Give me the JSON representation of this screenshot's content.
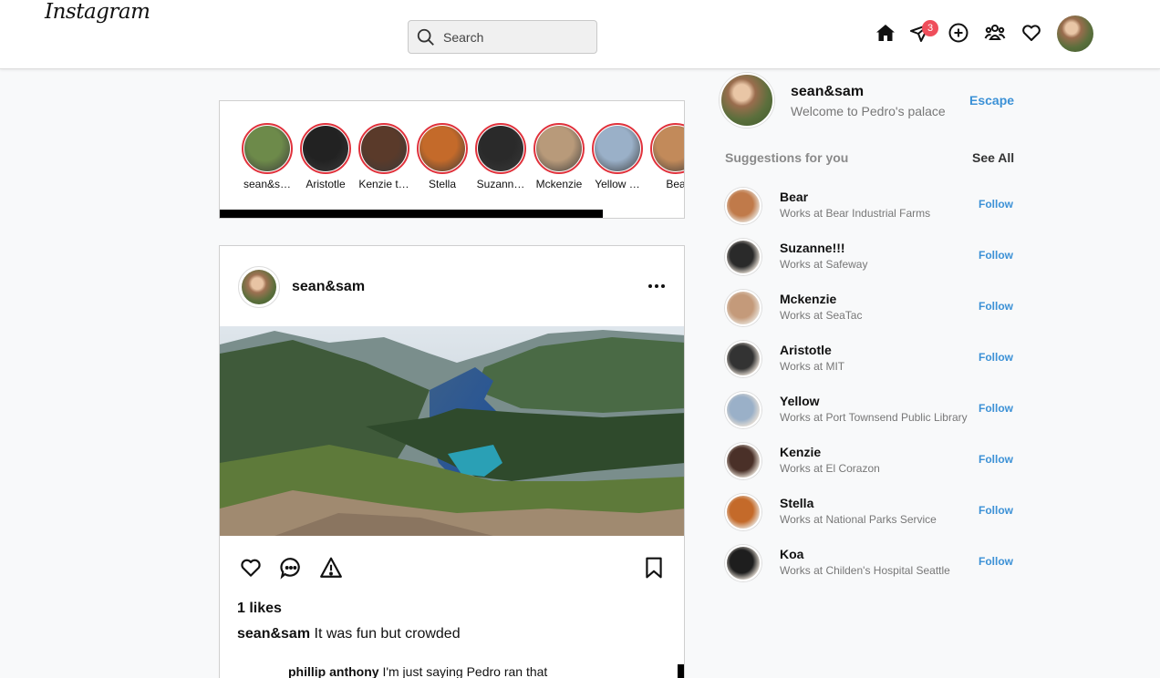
{
  "header": {
    "logo": "Instagram",
    "search_placeholder": "Search",
    "messages_badge": "3",
    "icons": [
      "home-icon",
      "direct-message-icon",
      "add-post-icon",
      "explore-people-icon",
      "activity-heart-icon",
      "profile-avatar"
    ]
  },
  "stories": [
    {
      "name": "sean&s…",
      "color": "#6d8a4a"
    },
    {
      "name": "Aristotle",
      "color": "#222222"
    },
    {
      "name": "Kenzie t…",
      "color": "#5a3a2a"
    },
    {
      "name": "Stella",
      "color": "#c46a2a"
    },
    {
      "name": "Suzann…",
      "color": "#2a2a2a"
    },
    {
      "name": "Mckenzie",
      "color": "#b89a7a"
    },
    {
      "name": "Yellow …",
      "color": "#9ab0c8"
    },
    {
      "name": "Bea",
      "color": "#c28a5a"
    }
  ],
  "post": {
    "username": "sean&sam",
    "likes": "1 likes",
    "caption_user": "sean&sam",
    "caption_text": "It was fun but crowded",
    "comment_user": "phillip anthony",
    "comment_text": "I'm just saying Pedro ran that"
  },
  "sidebar": {
    "username": "sean&sam",
    "subtitle": "Welcome to Pedro's palace",
    "escape_label": "Escape",
    "suggestions_title": "Suggestions for you",
    "see_all_label": "See All",
    "follow_label": "Follow",
    "suggestions": [
      {
        "name": "Bear",
        "sub": "Works at Bear Industrial Farms",
        "color": "#c07a4a"
      },
      {
        "name": "Suzanne!!!",
        "sub": "Works at Safeway",
        "color": "#2a2a2a"
      },
      {
        "name": "Mckenzie",
        "sub": "Works at SeaTac",
        "color": "#c49a7a"
      },
      {
        "name": "Aristotle",
        "sub": "Works at MIT",
        "color": "#333333"
      },
      {
        "name": "Yellow",
        "sub": "Works at Port Townsend Public Library",
        "color": "#9ab0c8"
      },
      {
        "name": "Kenzie",
        "sub": "Works at El Corazon",
        "color": "#4a3028"
      },
      {
        "name": "Stella",
        "sub": "Works at National Parks Service",
        "color": "#c46a2a"
      },
      {
        "name": "Koa",
        "sub": "Works at Childen's Hospital Seattle",
        "color": "#1e1e1e"
      }
    ]
  },
  "colors": {
    "accent": "#3c91d6",
    "story_ring": "#e0323c",
    "badge": "#ef4e5b",
    "background": "#f8f9fa"
  }
}
